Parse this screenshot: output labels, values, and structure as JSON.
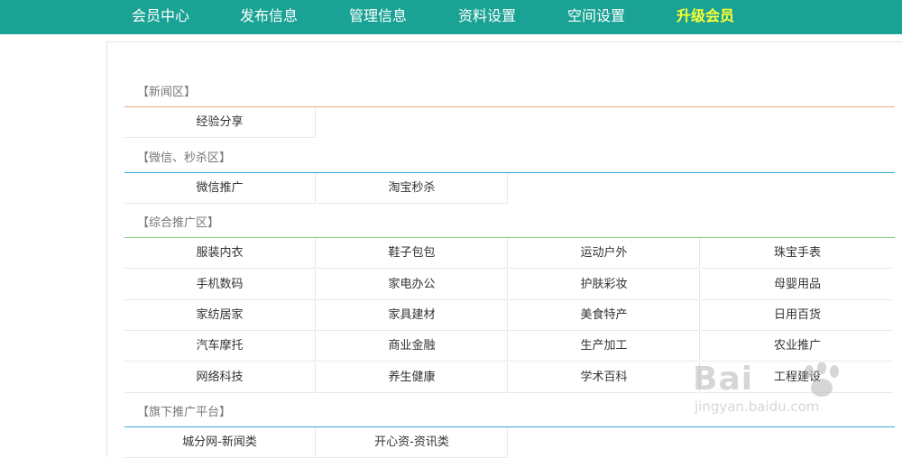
{
  "nav": [
    "会员中心",
    "发布信息",
    "管理信息",
    "资料设置",
    "空间设置",
    "升级会员"
  ],
  "sections": [
    {
      "title": "【新闻区】",
      "rows": [
        [
          "经验分享"
        ]
      ]
    },
    {
      "title": "【微信、秒杀区】",
      "rows": [
        [
          "微信推广",
          "淘宝秒杀"
        ]
      ]
    },
    {
      "title": "【综合推广区】",
      "rows": [
        [
          "服装内衣",
          "鞋子包包",
          "运动户外",
          "珠宝手表"
        ],
        [
          "手机数码",
          "家电办公",
          "护肤彩妆",
          "母婴用品"
        ],
        [
          "家纺居家",
          "家具建材",
          "美食特产",
          "日用百货"
        ],
        [
          "汽车摩托",
          "商业金融",
          "生产加工",
          "农业推广"
        ],
        [
          "网络科技",
          "养生健康",
          "学术百科",
          "工程建设"
        ]
      ]
    },
    {
      "title": "【旗下推广平台】",
      "rows": [
        [
          "城分网-新闻类",
          "开心资-资讯类"
        ]
      ]
    }
  ],
  "watermark": {
    "brand": "Bai",
    "url": "jingyan.baidu.com"
  },
  "colors": {
    "topbar": "#1aa394",
    "upgrade": "#ffff33",
    "line_news": "#f0a88a",
    "line_wechat": "#39a9dd",
    "line_general": "#7ed07e",
    "line_platform": "#39a9dd"
  }
}
